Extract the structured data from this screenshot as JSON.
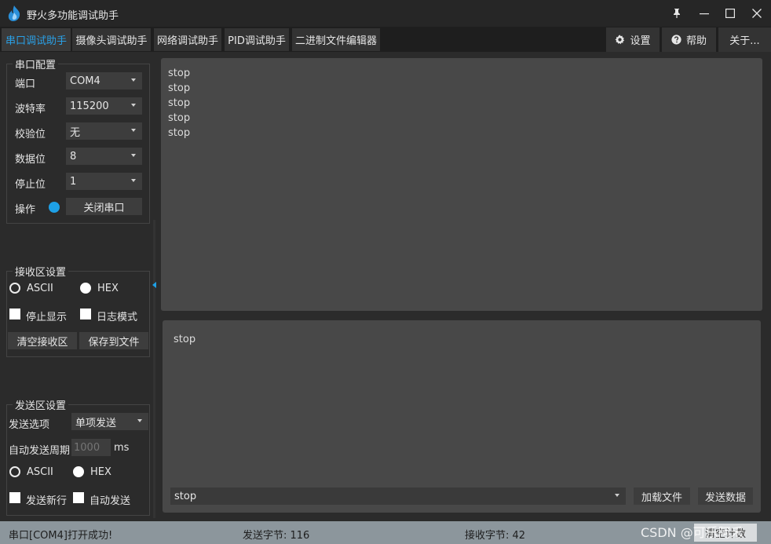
{
  "window": {
    "title": "野火多功能调试助手",
    "icon": "flame-logo-icon",
    "controls": [
      "pin-icon",
      "minimize-icon",
      "maximize-icon",
      "close-icon"
    ]
  },
  "tabs": [
    {
      "label": "串口调试助手",
      "active": true
    },
    {
      "label": "摄像头调试助手",
      "active": false
    },
    {
      "label": "网络调试助手",
      "active": false
    },
    {
      "label": "PID调试助手",
      "active": false
    },
    {
      "label": "二进制文件编辑器",
      "active": false
    }
  ],
  "right_tabs": {
    "settings": {
      "label": "设置",
      "icon": "gear-icon"
    },
    "help": {
      "label": "帮助",
      "icon": "help-circle-icon"
    },
    "about": {
      "label": "关于..."
    }
  },
  "serial_config": {
    "title": "串口配置",
    "port": {
      "label": "端口",
      "value": "COM4"
    },
    "baud": {
      "label": "波特率",
      "value": "115200"
    },
    "parity": {
      "label": "校验位",
      "value": "无"
    },
    "databits": {
      "label": "数据位",
      "value": "8"
    },
    "stopbits": {
      "label": "停止位",
      "value": "1"
    },
    "operation": {
      "label": "操作",
      "button": "关闭串口",
      "status_color": "#1ea0e6"
    }
  },
  "recv_settings": {
    "title": "接收区设置",
    "ascii": "ASCII",
    "hex": "HEX",
    "ascii_selected": true,
    "stop_display": "停止显示",
    "log_mode": "日志模式",
    "clear_button": "清空接收区",
    "save_button": "保存到文件"
  },
  "send_settings": {
    "title": "发送区设置",
    "option_label": "发送选项",
    "option_value": "单项发送",
    "period_label": "自动发送周期",
    "period_placeholder": "1000",
    "period_unit": "ms",
    "ascii": "ASCII",
    "hex": "HEX",
    "ascii_selected": true,
    "newline": "发送新行",
    "auto_send": "自动发送"
  },
  "receive_lines": [
    "stop",
    "stop",
    "stop",
    "stop",
    "stop"
  ],
  "send_text": "stop",
  "send_combo_value": "stop",
  "load_file_button": "加载文件",
  "send_button": "发送数据",
  "status": {
    "message": "串口[COM4]打开成功!",
    "sent_bytes": "发送字节: 116",
    "recv_bytes": "接收字节: 42",
    "watermark": "CSDN @可乐阿禾",
    "reset": "清空计数"
  },
  "colors": {
    "accent": "#2aa0e6",
    "background": "#2b2b2b",
    "text_area": "#484848",
    "status_bar": "#8c969c"
  }
}
